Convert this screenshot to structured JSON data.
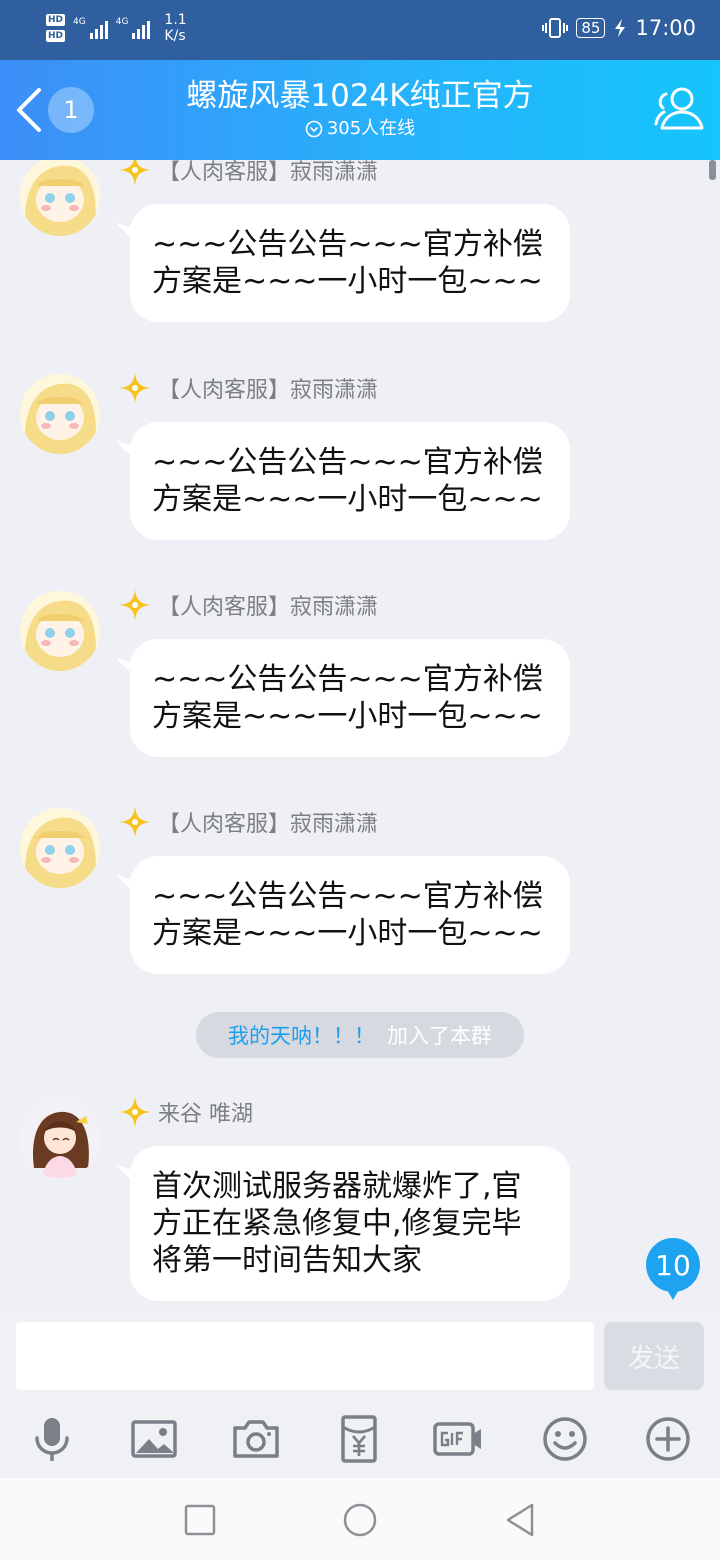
{
  "status_bar": {
    "network_1": "4G",
    "network_2": "4G",
    "hd_1": "HD",
    "hd_2": "HD",
    "speed_value": "1.1",
    "speed_unit": "K/s",
    "battery": "85",
    "time": "17:00"
  },
  "header": {
    "back_count": "1",
    "title": "螺旋风暴1024K纯正官方",
    "online_text": "305人在线",
    "accent_gradient": [
      "#3d8ef8",
      "#15c5fb"
    ]
  },
  "messages": [
    {
      "sender": "【人肉客服】寂雨潇潇",
      "text": "~~~公告公告~~~官方补偿方案是~~~一小时一包~~~"
    },
    {
      "sender": "【人肉客服】寂雨潇潇",
      "text": "~~~公告公告~~~官方补偿方案是~~~一小时一包~~~"
    },
    {
      "sender": "【人肉客服】寂雨潇潇",
      "text": "~~~公告公告~~~官方补偿方案是~~~一小时一包~~~"
    },
    {
      "sender": "【人肉客服】寂雨潇潇",
      "text": "~~~公告公告~~~官方补偿方案是~~~一小时一包~~~"
    }
  ],
  "system_notice": {
    "name": "我的天呐！！！",
    "text": "加入了本群"
  },
  "last_message": {
    "sender": "来谷 唯湖",
    "text": "首次测试服务器就爆炸了,官方正在紧急修复中,修复完毕将第一时间告知大家"
  },
  "unread_badge": "10",
  "input": {
    "value": "",
    "send_label": "发送"
  },
  "toolbar_icons": [
    "microphone-icon",
    "image-icon",
    "camera-icon",
    "red-packet-icon",
    "gif-icon",
    "emoji-icon",
    "plus-icon"
  ],
  "nav_icons": [
    "recent-apps-icon",
    "home-icon",
    "back-icon"
  ]
}
